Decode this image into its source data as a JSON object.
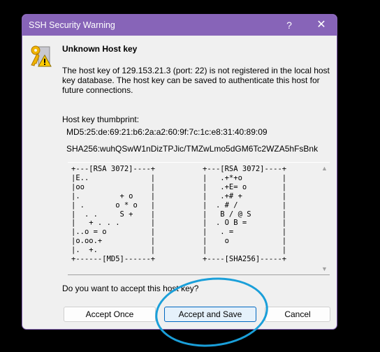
{
  "window": {
    "title": "SSH Security Warning",
    "help_label": "?",
    "close_label": "✕"
  },
  "icon": "key-warning-icon",
  "heading": "Unknown Host key",
  "message": "The host key of 129.153.21.3 (port: 22) is not registered in the local host key database. The host key can be saved to authenticate this host for future connections.",
  "thumbprint": {
    "label": "Host key thumbprint:",
    "md5": "MD5:25:de:69:21:b6:2a:a2:60:9f:7c:1c:e8:31:40:89:09",
    "sha256": "SHA256:wuhQSwW1nDizTPJic/TMZwLmo5dGM6Tc2WZA5hFsBnk"
  },
  "randomart": {
    "md5": "+---[RSA 3072]----+\n|E..              |\n|oo               |\n|.         + o    |\n| .       o * o   |\n|  . .     S +    |\n|   + . . .       |\n|..o = o          |\n|o.oo.+           |\n|.  +.            |\n+------[MD5]------+",
    "sha256": "+---[RSA 3072]----+\n|   .+*+o         |\n|   .+E= o        |\n|   .+# +         |\n|  . # /          |\n|   B / @ S       |\n|  . O B =        |\n|   . =           |\n|    o            |\n|                 |\n+----[SHA256]-----+"
  },
  "question": "Do you want to accept this host key?",
  "buttons": {
    "accept_once": "Accept Once",
    "accept_save": "Accept and Save",
    "cancel": "Cancel"
  },
  "colors": {
    "titlebar": "#8764b8",
    "annotation": "#1a9fd9"
  }
}
